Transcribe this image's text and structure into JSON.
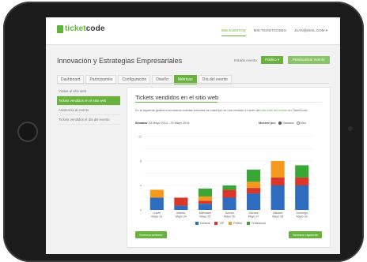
{
  "brand": {
    "name_left": "ticket",
    "name_right": "code"
  },
  "nav": {
    "items": [
      {
        "label": "MIS EVENTOS",
        "active": true
      },
      {
        "label": "MIS TICKETCODES",
        "active": false
      },
      {
        "label": "JUAN@MAIL.COM ▾",
        "active": false
      }
    ]
  },
  "event": {
    "title": "Innovación y Estrategias Empresariales",
    "status_label": "Estado evento",
    "status_button": "Público ▾",
    "publish_button": "Previsualizar evento"
  },
  "tabs": [
    {
      "label": "Dashboard",
      "active": false
    },
    {
      "label": "Participantes",
      "active": false
    },
    {
      "label": "Configuración",
      "active": false
    },
    {
      "label": "Diseño",
      "active": false
    },
    {
      "label": "Métricas",
      "active": true
    },
    {
      "label": "Día del evento",
      "active": false
    }
  ],
  "sidebar": {
    "items": [
      {
        "label": "Visitas al sitio web",
        "active": false
      },
      {
        "label": "Tickets vendidos en el sitio web",
        "active": true
      },
      {
        "label": "Asistencia al evento",
        "active": false
      },
      {
        "label": "Tickets vendidos el día del evento",
        "active": false
      }
    ]
  },
  "panel": {
    "title": "Tickets vendidos en el sitio web",
    "desc_prefix": "En la siguiente gráfica encontrarás cuántas entradas de cada tipo se han vendido a través del ",
    "desc_link": "sitio web del evento",
    "desc_suffix": " en TicketCode.",
    "week_label": "Semana:",
    "week_value": "23 Mayo 2014 - 29 Mayo 2014",
    "show_by_label": "Mostrar por:",
    "show_by_options": [
      {
        "label": "Semana",
        "selected": true
      },
      {
        "label": "Mes",
        "selected": false
      }
    ],
    "prev_button": "Semana anterior",
    "next_button": "Semana siguiente"
  },
  "chart_data": {
    "type": "bar",
    "stacked": true,
    "categories": [
      "Lunes",
      "Martes",
      "Miércoles",
      "Jueves",
      "Viernes",
      "Sábado",
      "Domingo"
    ],
    "category_dates": [
      "Mayo 23",
      "Mayo 24",
      "Mayo 25",
      "Mayo 26",
      "Mayo 27",
      "Mayo 28",
      "Mayo 29"
    ],
    "series": [
      {
        "name": "General",
        "color": "#2e6cc0",
        "values": [
          2,
          0.7,
          1,
          2,
          2.7,
          4,
          4
        ]
      },
      {
        "name": "VIP",
        "color": "#d9372a",
        "values": [
          0,
          1.3,
          0.5,
          1.3,
          0.9,
          1.3,
          1.3
        ]
      },
      {
        "name": "Prefino",
        "color": "#f49a1c",
        "values": [
          1.3,
          0,
          0.7,
          0,
          1,
          2.7,
          0
        ]
      },
      {
        "name": "Profesional",
        "color": "#3aa636",
        "values": [
          0,
          0,
          1.3,
          0.7,
          2,
          0,
          2
        ]
      }
    ],
    "ylim": [
      0,
      12
    ],
    "yticks": [
      0,
      2,
      4,
      6,
      8,
      10,
      12
    ],
    "ytick_labels": [
      "0",
      "",
      "4",
      "",
      "8",
      "",
      "12"
    ],
    "grid": true,
    "legend": "bottom"
  }
}
